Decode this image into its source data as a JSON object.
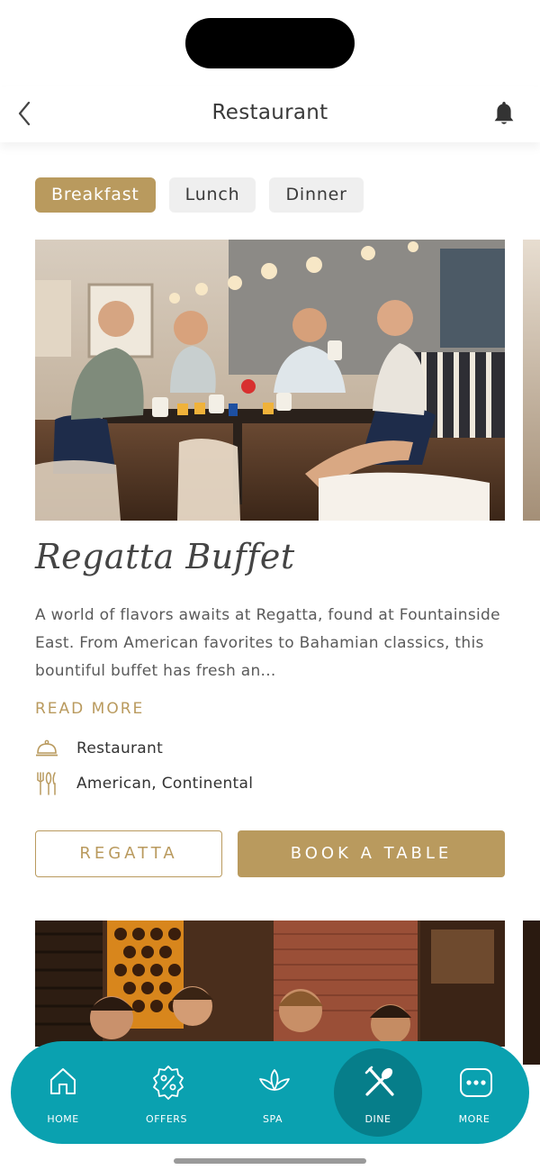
{
  "header": {
    "title": "Restaurant",
    "back_icon": "chevron-left-icon",
    "bell_icon": "bell-icon"
  },
  "meal_tabs": [
    {
      "label": "Breakfast",
      "active": true
    },
    {
      "label": "Lunch",
      "active": false
    },
    {
      "label": "Dinner",
      "active": false
    }
  ],
  "card": {
    "name": "Regatta Buffet",
    "description": "A world of flavors awaits at Regatta, found at Fountainside East. From American favorites to Bahamian classics, this bountiful buffet has fresh an...",
    "read_more": "READ MORE",
    "info": [
      {
        "icon": "cloche-icon",
        "text": "Restaurant"
      },
      {
        "icon": "cutlery-icon",
        "text": "American, Continental"
      }
    ],
    "secondary_button": "REGATTA",
    "primary_button": "BOOK A TABLE"
  },
  "tabbar": {
    "items": [
      {
        "label": "HOME",
        "icon": "home-icon",
        "active": false
      },
      {
        "label": "OFFERS",
        "icon": "percent-badge-icon",
        "active": false
      },
      {
        "label": "SPA",
        "icon": "lotus-icon",
        "active": false
      },
      {
        "label": "DINE",
        "icon": "utensils-icon",
        "active": true
      },
      {
        "label": "MORE",
        "icon": "more-icon",
        "active": false
      }
    ]
  },
  "colors": {
    "accent_gold": "#b99a5e",
    "tabbar_teal": "#0aa1b0",
    "tabbar_active": "#067e8a"
  }
}
